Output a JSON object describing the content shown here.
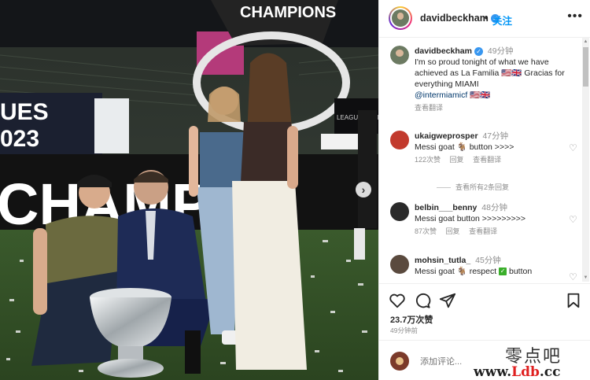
{
  "post": {
    "username": "davidbeckham",
    "follow_label": "关注",
    "dot": "•",
    "more": "•••"
  },
  "photo": {
    "banner_text": "CHAMPIONS",
    "stand_text_1": "UES",
    "stand_text_2": "023",
    "board_text": "CHAMPI",
    "tv_text": "LEAGUES CUP",
    "next_arrow": "›"
  },
  "caption": {
    "username": "davidbeckham",
    "time": "49分钟",
    "text": "I'm so proud tonight of what we have achieved as La Familia 🇺🇸🇬🇧 Gracias for everything MIAMI",
    "mention": "@intermiamicf",
    "emoji_tail": "🇺🇸🇬🇧",
    "translate": "查看翻译"
  },
  "comments": [
    {
      "username": "ukaigweprosper",
      "time": "47分钟",
      "text_a": "Messi goat ",
      "goat": "🐐",
      "text_b": " button >>>>",
      "likes": "122次赞",
      "reply": "回复",
      "translate": "查看翻译"
    },
    {
      "username": "belbin___benny",
      "time": "48分钟",
      "text": "Messi goat button >>>>>>>>>",
      "likes": "87次赞",
      "reply": "回复",
      "translate": "查看翻译"
    },
    {
      "username": "mohsin_tutla_",
      "time": "45分钟",
      "text_a": "Messi goat ",
      "goat": "🐐",
      "text_b": " respect ",
      "check": "✓",
      "text_c": " button"
    }
  ],
  "view_replies": "查看所有2条回复",
  "likes_count": "23.7万次赞",
  "posted_ago": "49分钟前",
  "add_comment_placeholder": "添加评论...",
  "watermark": {
    "line1": "零点吧",
    "line2_a": "www.",
    "line2_b": "Ldb",
    "line2_c": ".cc"
  },
  "icons": [
    "heart-icon",
    "comment-icon",
    "share-icon",
    "bookmark-icon",
    "more-icon",
    "verified-icon",
    "chevron-right-icon"
  ]
}
